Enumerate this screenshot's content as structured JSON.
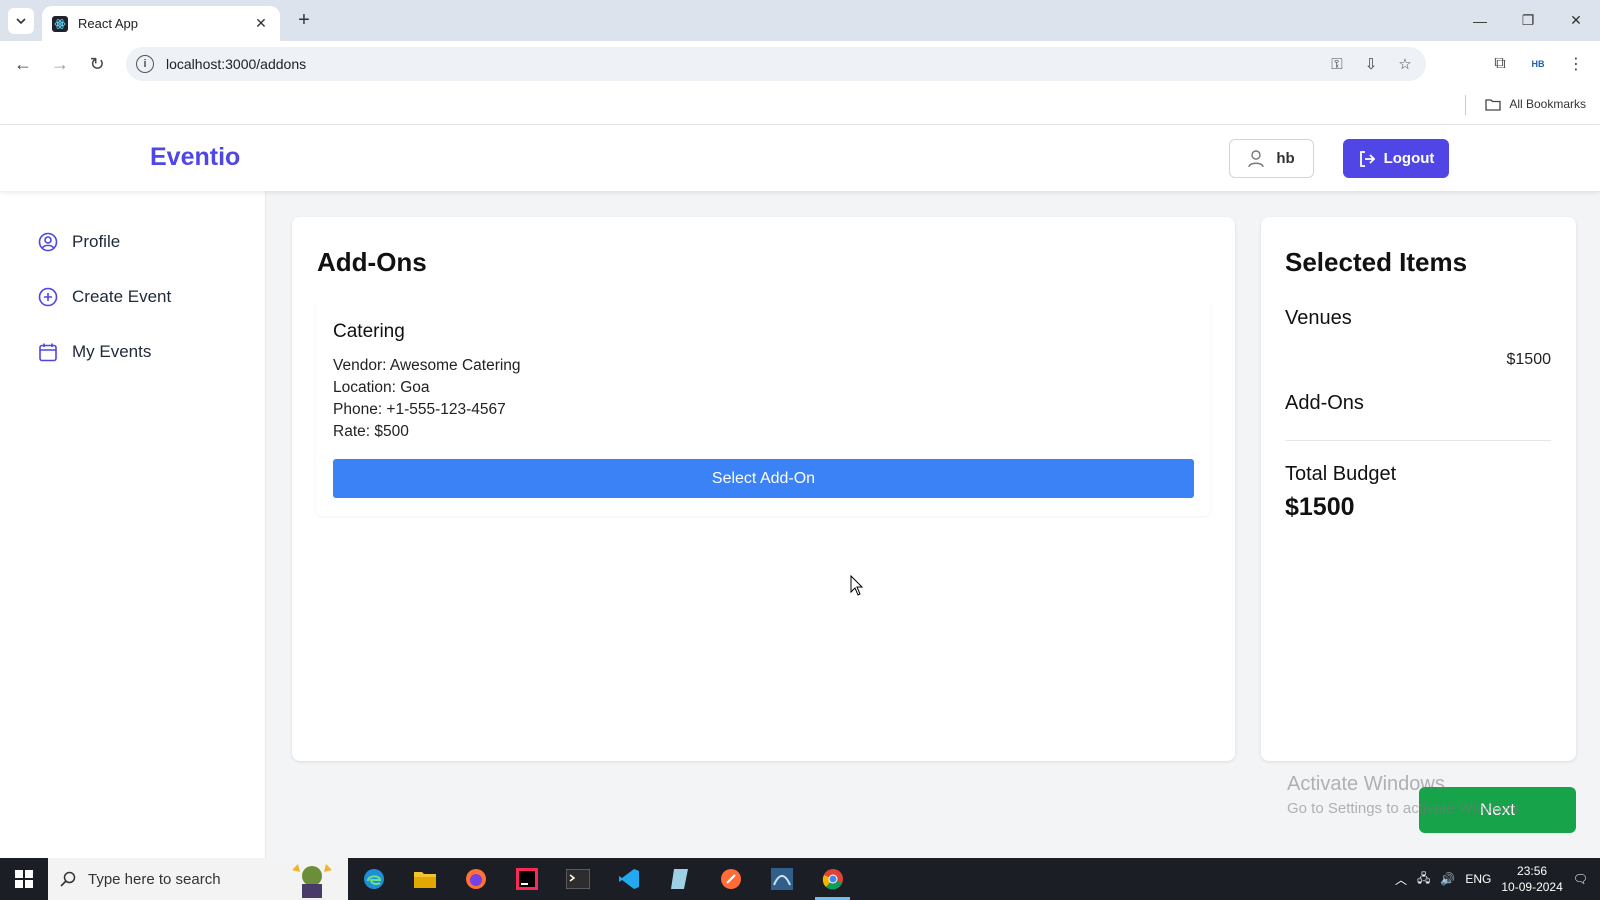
{
  "browser": {
    "tab_title": "React App",
    "url": "localhost:3000/addons",
    "bookmarks_label": "All Bookmarks",
    "profile_initials": "HB"
  },
  "header": {
    "brand": "Eventio",
    "username": "hb",
    "logout_label": "Logout"
  },
  "sidebar": {
    "items": [
      {
        "label": "Profile",
        "icon": "user-circle-icon"
      },
      {
        "label": "Create Event",
        "icon": "plus-circle-icon"
      },
      {
        "label": "My Events",
        "icon": "calendar-icon"
      }
    ]
  },
  "main": {
    "title": "Add-Ons",
    "addons": [
      {
        "name": "Catering",
        "vendor": "Vendor: Awesome Catering",
        "location": "Location: Goa",
        "phone": "Phone: +1-555-123-4567",
        "rate": "Rate: $500",
        "button_label": "Select Add-On"
      }
    ]
  },
  "selected": {
    "title": "Selected Items",
    "venues_label": "Venues",
    "venue_price": "$1500",
    "addons_label": "Add-Ons",
    "total_label": "Total Budget",
    "total_value": "$1500"
  },
  "next_label": "Next",
  "watermark": {
    "line1": "Activate Windows",
    "line2": "Go to Settings to activate Windows."
  },
  "taskbar": {
    "search_placeholder": "Type here to search",
    "language": "ENG",
    "time": "23:56",
    "date": "10-09-2024"
  },
  "colors": {
    "brand": "#4f46e5",
    "select_button": "#3b82f6",
    "next_button": "#16a34a"
  }
}
